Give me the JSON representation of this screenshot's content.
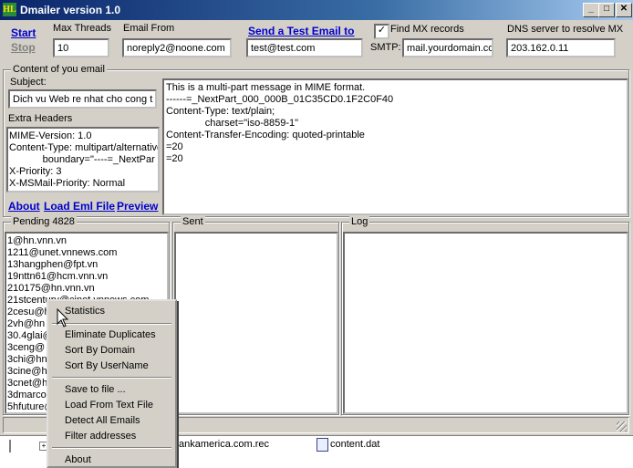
{
  "window": {
    "title": "Dmailer version 1.0",
    "icon_glyph": "HL",
    "minimize": "_",
    "maximize": "□",
    "close": "✕"
  },
  "toolbar": {
    "start_label": "Start",
    "stop_label": "Stop",
    "max_threads_label": "Max Threads",
    "max_threads_value": "10",
    "email_from_label": "Email From",
    "email_from_value": "noreply2@noone.com",
    "send_test_label": "Send a Test Email to",
    "test_email_value": "test@test.com",
    "find_mx_label": "Find MX records",
    "find_mx_checked": true,
    "smtp_label": "SMTP:",
    "smtp_value": "mail.yourdomain.co",
    "dns_label": "DNS server to resolve MX",
    "dns_value": "203.162.0.11"
  },
  "content": {
    "group_label": "Content of you email",
    "subject_label": "Subject:",
    "subject_value": "Dich vu Web re nhat cho cong t",
    "extra_headers_label": "Extra Headers",
    "extra_headers_lines": [
      "MIME-Version: 1.0",
      "Content-Type: multipart/alternative",
      "            boundary=\"----=_NextPar",
      "X-Priority: 3",
      "X-MSMail-Priority: Normal"
    ],
    "body_lines": [
      "This is a multi-part message in MIME format.",
      "",
      "------=_NextPart_000_000B_01C35CD0.1F2C0F40",
      "Content-Type: text/plain;",
      "              charset=\"iso-8859-1\"",
      "Content-Transfer-Encoding: quoted-printable",
      "",
      "=20",
      "",
      "=20"
    ],
    "about_link": "About",
    "load_eml_link": "Load Eml File",
    "preview_link": "Preview"
  },
  "pending": {
    "label": "Pending 4828",
    "items": [
      "1@hn.vnn.vn",
      "1211@unet.vnnews.com",
      "13hangphen@fpt.vn",
      "19nttn61@hcm.vnn.vn",
      "210175@hn.vnn.vn",
      "21stcentury@cinet.vnnews.com",
      "2cesu@h",
      "2vh@hn",
      "30.4glai@",
      "3ceng@",
      "3chi@hn",
      "3cine@h",
      "3cnet@h",
      "3dmarco",
      "5hfuture@"
    ]
  },
  "sent": {
    "label": "Sent"
  },
  "log": {
    "label": "Log"
  },
  "context_menu": {
    "items": [
      "Statistics",
      "Eliminate Duplicates",
      "Sort By Domain",
      "Sort By UserName",
      "Save to file ...",
      "Load From Text File",
      "Detect All Emails",
      "Filter addresses",
      "About"
    ]
  },
  "taskbar": {
    "file1": "ankamerica.com.rec",
    "file2": "content.dat"
  }
}
